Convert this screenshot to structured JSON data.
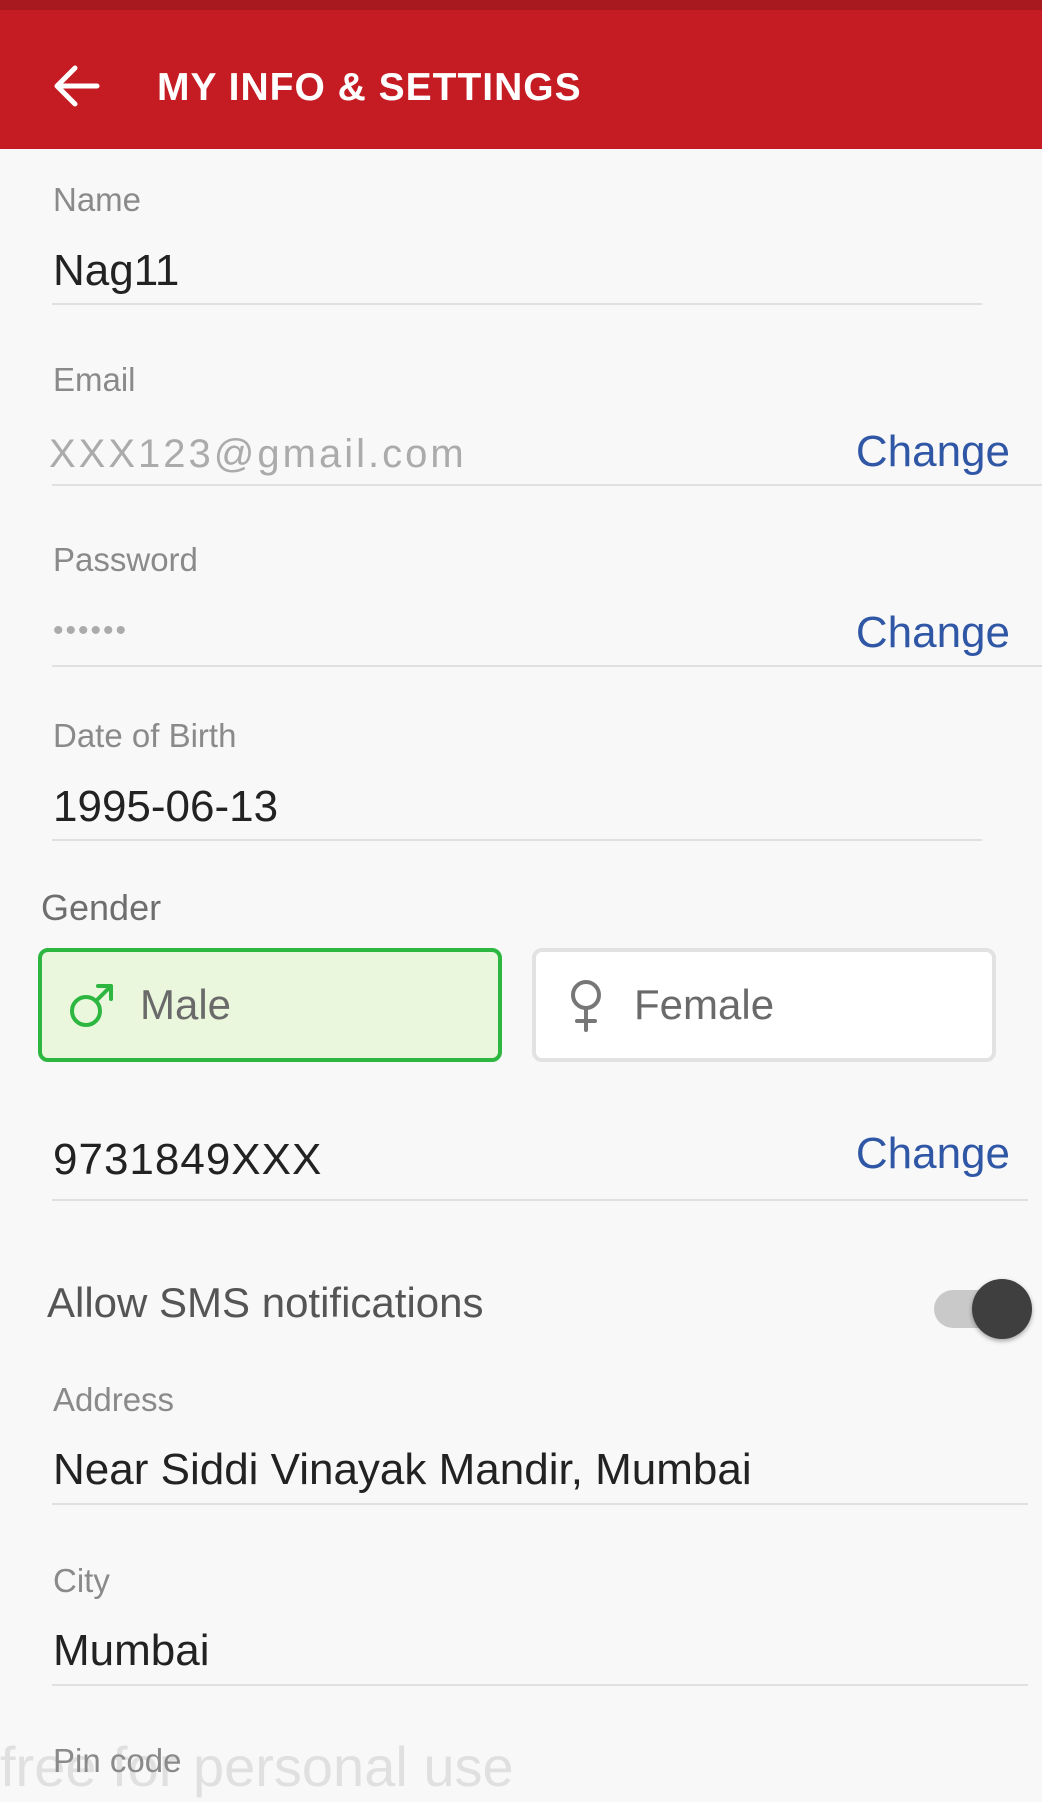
{
  "app_bar": {
    "title": "MY INFO & SETTINGS"
  },
  "form": {
    "name": {
      "label": "Name",
      "value": "Nag11"
    },
    "email": {
      "label": "Email",
      "value": "XXX123@gmail.com",
      "action": "Change"
    },
    "password": {
      "label": "Password",
      "value": "••••••",
      "action": "Change"
    },
    "dob": {
      "label": "Date of Birth",
      "value": "1995-06-13"
    },
    "gender": {
      "label": "Gender",
      "options": [
        {
          "label": "Male",
          "selected": true,
          "icon": "male-icon"
        },
        {
          "label": "Female",
          "selected": false,
          "icon": "female-icon"
        }
      ]
    },
    "phone": {
      "value": "9731849XXX",
      "action": "Change"
    },
    "sms": {
      "label": "Allow SMS notifications",
      "enabled": true
    },
    "address": {
      "label": "Address",
      "value": "Near Siddi Vinayak Mandir, Mumbai"
    },
    "city": {
      "label": "City",
      "value": "Mumbai"
    },
    "pincode": {
      "label": "Pin code"
    }
  },
  "watermark": "free for personal use",
  "colors": {
    "app_bar": "#c51c24",
    "link": "#3057a5",
    "selected_border": "#2db640",
    "selected_fill": "#eaf7dd"
  }
}
